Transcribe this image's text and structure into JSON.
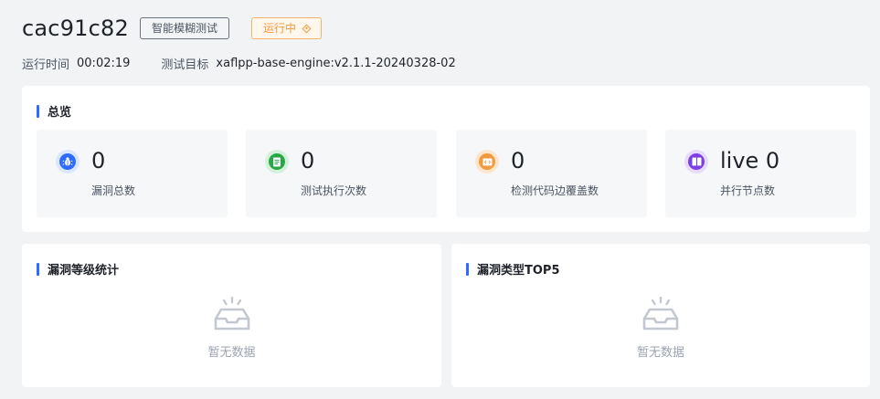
{
  "header": {
    "title": "cac91c82",
    "type_tag": "智能模糊测试",
    "status_tag": "运行中",
    "runtime_label": "运行时间",
    "runtime_value": "00:02:19",
    "target_label": "测试目标",
    "target_value": "xaflpp-base-engine:v2.1.1-20240328-02"
  },
  "overview": {
    "title": "总览",
    "stats": [
      {
        "icon": "bug-icon",
        "value": "0",
        "label": "漏洞总数",
        "color": "#2f6bff"
      },
      {
        "icon": "document-icon",
        "value": "0",
        "label": "测试执行次数",
        "color": "#28a745"
      },
      {
        "icon": "code-icon",
        "value": "0",
        "label": "检测代码边覆盖数",
        "color": "#f19a3e"
      },
      {
        "icon": "book-icon",
        "value": "live 0",
        "label": "并行节点数",
        "color": "#7b3fe4"
      }
    ]
  },
  "severity_panel": {
    "title": "漏洞等级统计",
    "empty_text": "暂无数据"
  },
  "top5_panel": {
    "title": "漏洞类型TOP5",
    "empty_text": "暂无数据"
  },
  "colors": {
    "accent": "#2f6bff",
    "status": "#f19a3e",
    "background": "#f2f3f5"
  }
}
